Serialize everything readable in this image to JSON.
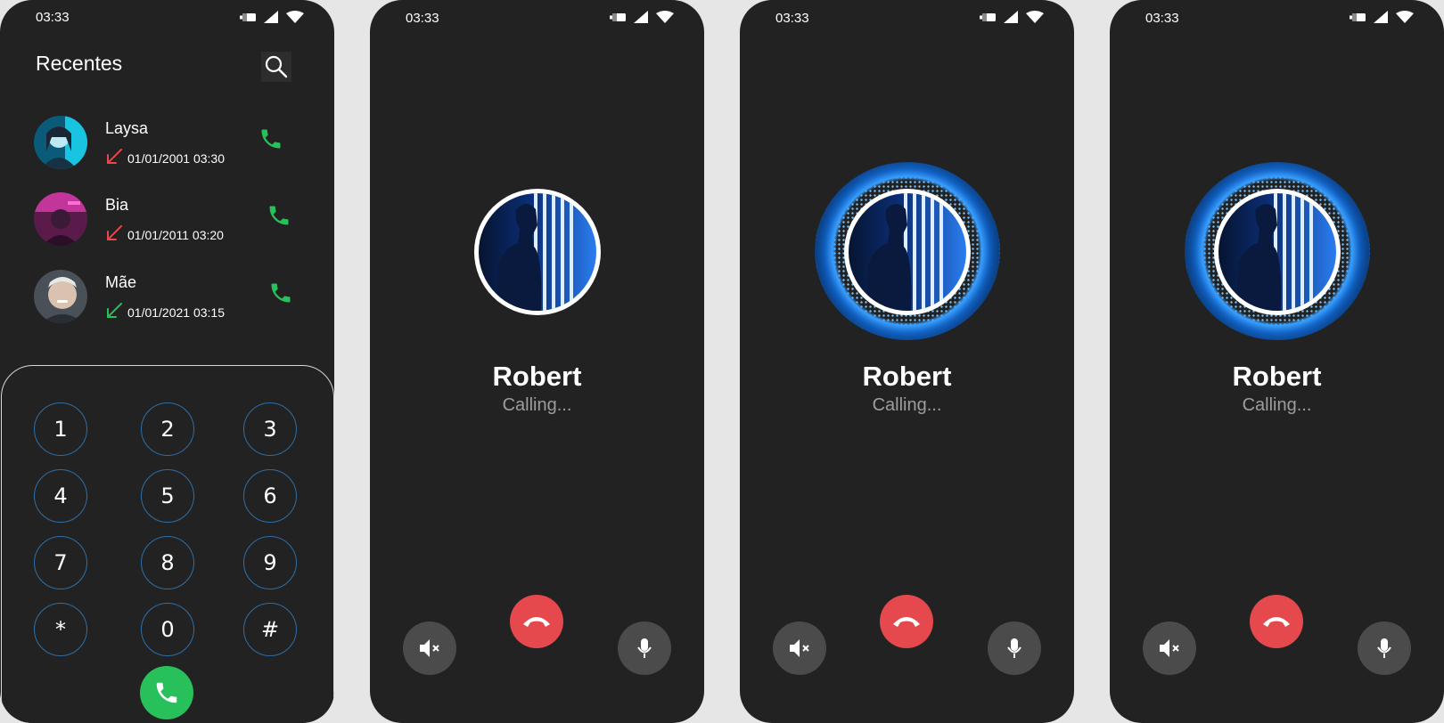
{
  "status": {
    "time": "03:33"
  },
  "recents": {
    "title": "Recentes",
    "items": [
      {
        "name": "Laysa",
        "datetime": "01/01/2001 03:30",
        "call_type": "missed",
        "arrow_color": "#e5484d"
      },
      {
        "name": "Bia",
        "datetime": "01/01/2011 03:20",
        "call_type": "missed",
        "arrow_color": "#e5484d"
      },
      {
        "name": "Mãe",
        "datetime": "01/01/2021 03:15",
        "call_type": "received",
        "arrow_color": "#27c05a"
      }
    ]
  },
  "dialer": {
    "keys": [
      "1",
      "2",
      "3",
      "4",
      "5",
      "6",
      "7",
      "8",
      "9",
      "*",
      "0",
      "#"
    ]
  },
  "calling": {
    "name": "Robert",
    "status": "Calling..."
  },
  "colors": {
    "background": "#222222",
    "call_green": "#27c05a",
    "end_red": "#e5484d",
    "key_border": "#2f6ea5",
    "secondary_button": "#4b4b4b"
  },
  "icons": {
    "status": [
      "battery-icon",
      "signal-icon",
      "wifi-icon"
    ],
    "search": "search-icon",
    "call": "phone-icon",
    "end": "end-call-icon",
    "mute": "speaker-mute-icon",
    "mic": "microphone-icon"
  }
}
